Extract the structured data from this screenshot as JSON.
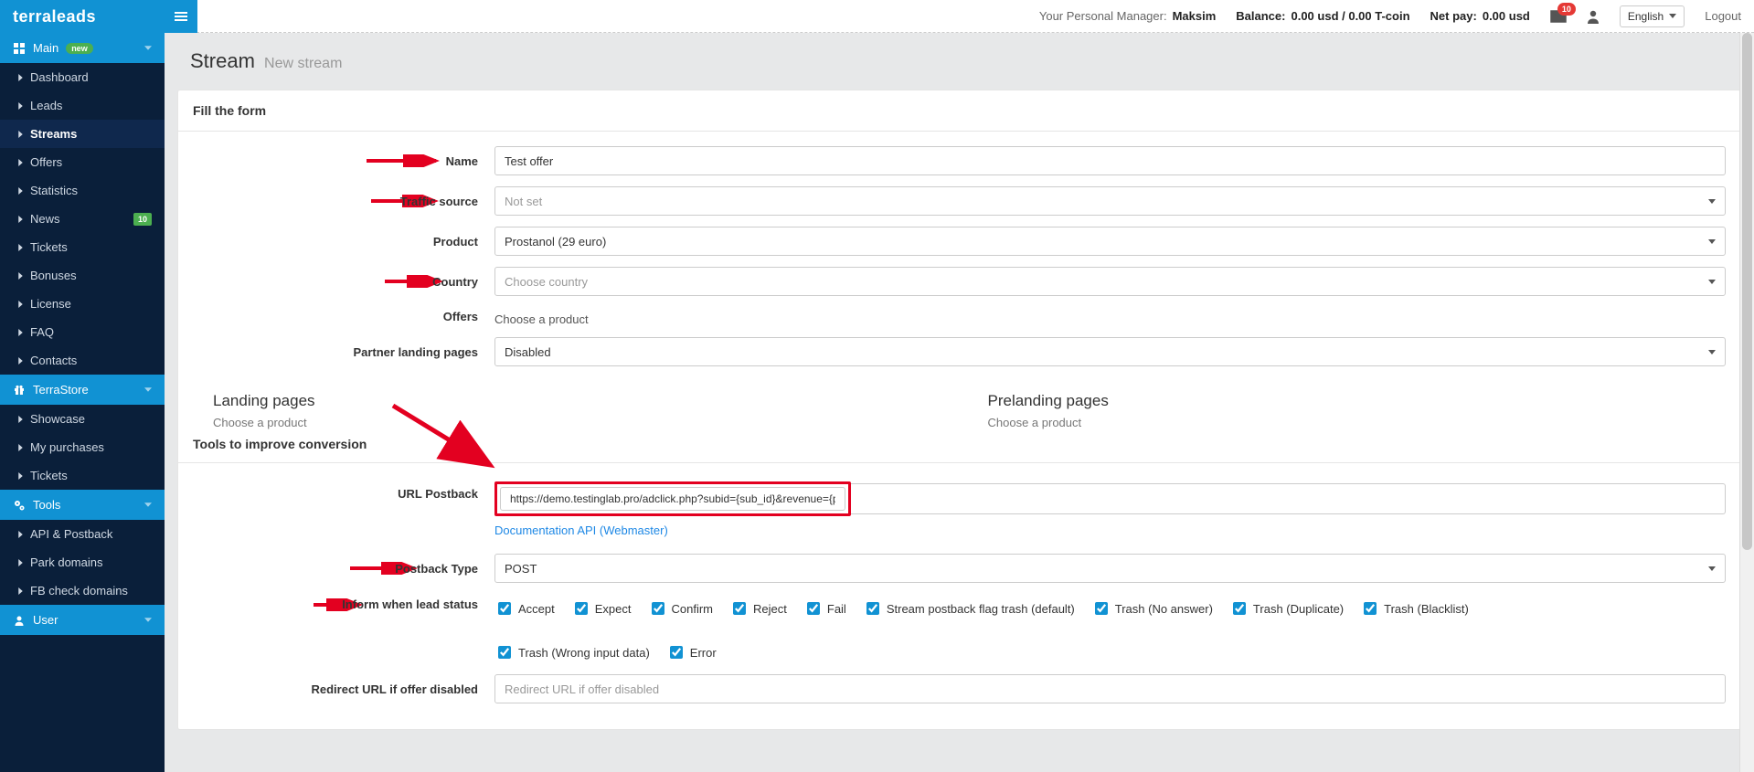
{
  "brand": {
    "part1": "terra",
    "part2": " leads"
  },
  "sidebar": {
    "main": {
      "label": "Main",
      "badge": "new"
    },
    "mainItems": [
      "Dashboard",
      "Leads",
      "Streams",
      "Offers",
      "Statistics",
      "News",
      "Tickets",
      "Bonuses",
      "License",
      "FAQ",
      "Contacts"
    ],
    "mainNewsBadge": "10",
    "store": {
      "label": "TerraStore"
    },
    "storeItems": [
      "Showcase",
      "My purchases",
      "Tickets"
    ],
    "tools": {
      "label": "Tools"
    },
    "toolsItems": [
      "API & Postback",
      "Park domains",
      "FB check domains"
    ],
    "user": {
      "label": "User"
    }
  },
  "topbar": {
    "managerLabel": "Your Personal Manager: ",
    "managerName": "Maksim",
    "balanceLabel": "Balance: ",
    "balanceValue": "0.00 usd / 0.00 T-coin",
    "netpayLabel": "Net pay: ",
    "netpayValue": "0.00 usd",
    "notifCount": "10",
    "language": "English",
    "logout": "Logout"
  },
  "page": {
    "title": "Stream",
    "sub": "New stream"
  },
  "panel": {
    "title": "Fill the form"
  },
  "form": {
    "name": {
      "label": "Name",
      "value": "Test offer"
    },
    "traffic": {
      "label": "Traffic source",
      "placeholder": "Not set"
    },
    "product": {
      "label": "Product",
      "value": "Prostanol (29 euro)"
    },
    "country": {
      "label": "Country",
      "placeholder": "Choose country"
    },
    "offers": {
      "label": "Offers",
      "value": "Choose a product"
    },
    "partner": {
      "label": "Partner landing pages",
      "value": "Disabled"
    },
    "landing": {
      "title": "Landing pages",
      "hint": "Choose a product"
    },
    "prelanding": {
      "title": "Prelanding pages",
      "hint": "Choose a product"
    },
    "conversionTools": "Tools to improve conversion",
    "postback": {
      "label": "URL Postback",
      "value": "https://demo.testinglab.pro/adclick.php?subid={sub_id}&revenue={payment}",
      "docLink": "Documentation API (Webmaster)"
    },
    "postbackType": {
      "label": "Postback Type",
      "value": "POST"
    },
    "inform": {
      "label": "Inform when lead status",
      "row1": [
        "Accept",
        "Expect",
        "Confirm",
        "Reject",
        "Fail",
        "Stream postback flag trash (default)",
        "Trash (No answer)",
        "Trash (Duplicate)",
        "Trash (Blacklist)"
      ],
      "row2": [
        "Trash (Wrong input data)",
        "Error"
      ]
    },
    "redirect": {
      "label": "Redirect URL if offer disabled",
      "placeholder": "Redirect URL if offer disabled"
    }
  }
}
